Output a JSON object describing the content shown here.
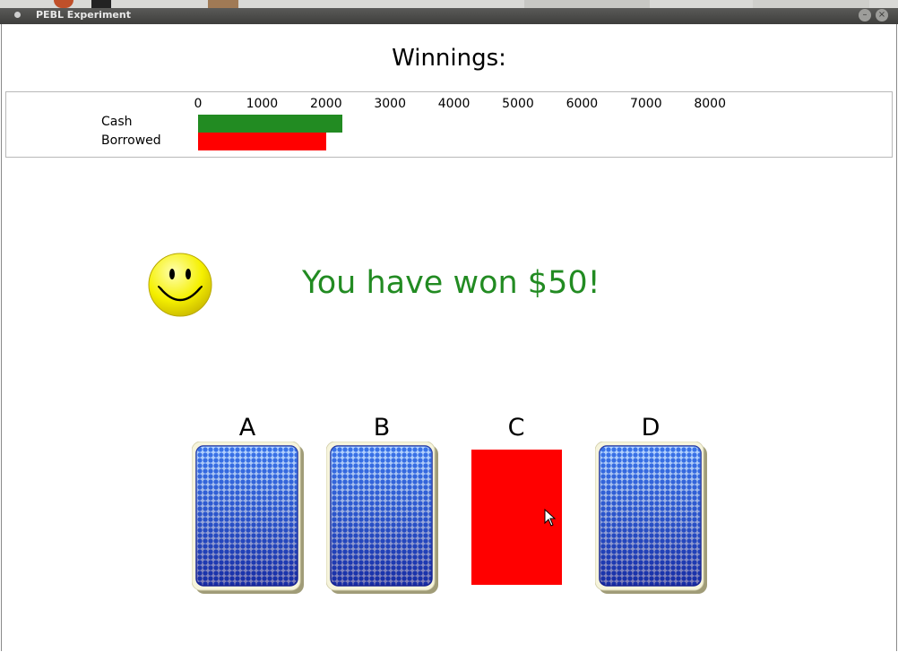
{
  "window": {
    "title": "PEBL Experiment",
    "minimize_glyph": "–",
    "close_glyph": "×"
  },
  "heading": "Winnings:",
  "chart_data": {
    "type": "bar",
    "orientation": "horizontal",
    "categories": [
      "Cash",
      "Borrowed"
    ],
    "values": [
      2250,
      2000
    ],
    "xlim": [
      0,
      8000
    ],
    "xticks": [
      "0",
      "1000",
      "2000",
      "3000",
      "4000",
      "5000",
      "6000",
      "7000",
      "8000"
    ],
    "colors": [
      "#228b22",
      "#ff0000"
    ]
  },
  "feedback": {
    "icon": "smiley-face-icon",
    "message": "You have won $50!",
    "color": "#228b22"
  },
  "decks": [
    {
      "label": "A",
      "state": "face-down"
    },
    {
      "label": "B",
      "state": "face-down"
    },
    {
      "label": "C",
      "state": "selected",
      "color": "#ff0000"
    },
    {
      "label": "D",
      "state": "face-down"
    }
  ]
}
